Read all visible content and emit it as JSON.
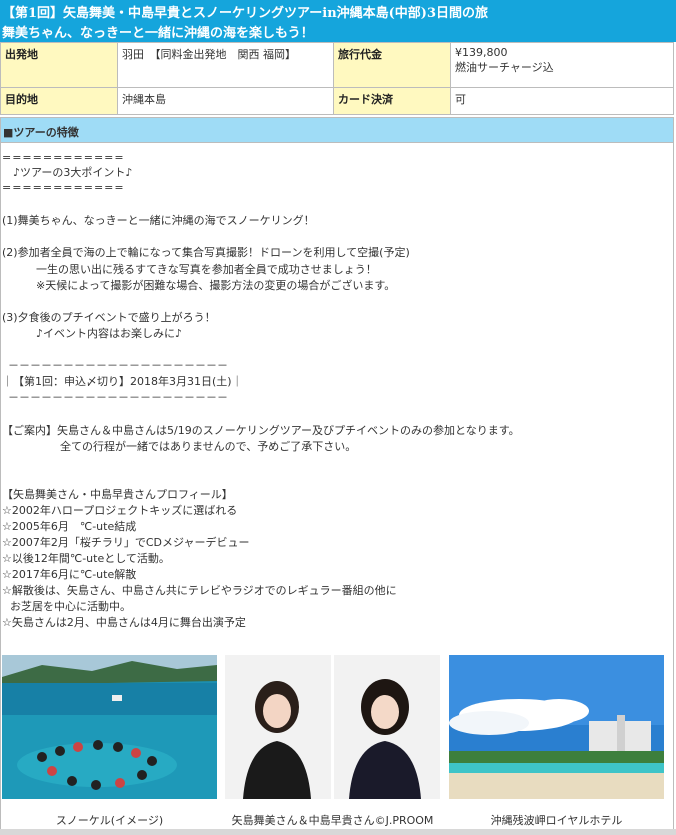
{
  "header": {
    "title_line1": "【第1回】矢島舞美・中島早貴とスノーケリングツアーin沖縄本島(中部)3日間の旅",
    "title_line2": "舞美ちゃん、なっきーと一緒に沖縄の海を楽しもう！"
  },
  "info": {
    "departure_label": "出発地",
    "departure_value": "羽田　【同料金出発地　関西 福岡】",
    "price_label": "旅行代金",
    "price_value": "¥139,800",
    "price_note": "燃油サーチャージ込",
    "destination_label": "目的地",
    "destination_value": "沖縄本島",
    "card_label": "カード決済",
    "card_value": "可"
  },
  "section": {
    "title": "■ツアーの特徴"
  },
  "body": {
    "l01": "============",
    "l02": "　♪ツアーの3大ポイント♪",
    "l03": "============",
    "l04": "(1)舞美ちゃん、なっきーと一緒に沖縄の海でスノーケリング！",
    "l05": "(2)参加者全員で海の上で輪になって集合写真撮影！ドローンを利用して空撮(予定)",
    "l06": "一生の思い出に残るすてきな写真を参加者全員で成功させましょう！",
    "l07": "※天候によって撮影が困難な場合、撮影方法の変更の場合がございます。",
    "l08": "(3)夕食後のプチイベントで盛り上がろう！",
    "l09": "♪イベント内容はお楽しみに♪",
    "l10": "－－－－－－－－－－－－－－－－－－－－",
    "l11": "｜【第1回：申込〆切り】2018年3月31日(土)｜",
    "l12": "－－－－－－－－－－－－－－－－－－－－",
    "l13": "【ご案内】矢島さん＆中島さんは5/19のスノーケリングツアー及びプチイベントのみの参加となります。",
    "l14": "全ての行程が一緒ではありませんので、予めご了承下さい。",
    "l15": "【矢島舞美さん・中島早貴さんプロフィール】",
    "l16": "☆2002年ハロープロジェクトキッズに選ばれる",
    "l17": "☆2005年6月　℃-ute結成",
    "l18": "☆2007年2月「桜チラリ」でCDメジャーデビュー",
    "l19": "☆以後12年間℃-uteとして活動。",
    "l20": "☆2017年6月に℃-ute解散",
    "l21": "☆解散後は、矢島さん、中島さん共にテレビやラジオでのレギュラー番組の他に",
    "l22": "お芝居を中心に活動中。",
    "l23": "☆矢島さんは2月、中島さんは4月に舞台出演予定"
  },
  "photos": {
    "cap1": "スノーケル(イメージ)",
    "cap2": "矢島舞美さん＆中島早貴さん©J.PROOM",
    "cap3": "沖縄残波岬ロイヤルホテル"
  },
  "colors": {
    "header_bg": "#15a5dc",
    "section_bg": "#9fdcf6",
    "label_bg": "#fff9c0"
  }
}
